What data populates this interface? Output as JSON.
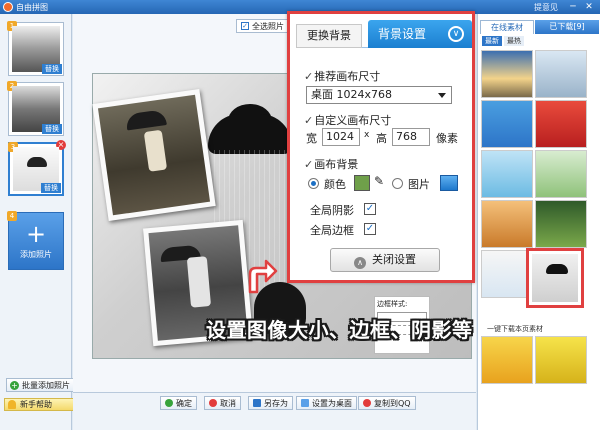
{
  "window": {
    "title": "自由拼图",
    "feedback": "提意见",
    "min_glyph": "─",
    "close_glyph": "✕"
  },
  "left_panel": {
    "thumbnails": [
      {
        "index": "1",
        "swap_label": "替换",
        "selected": false
      },
      {
        "index": "2",
        "swap_label": "替换",
        "selected": false
      },
      {
        "index": "3",
        "swap_label": "替换",
        "selected": true
      },
      {
        "index": "4",
        "swap_label": "",
        "selected": false
      }
    ],
    "add_photo_label": "添加照片",
    "batch_add_label": "批量添加照片",
    "help_label": "新手帮助"
  },
  "toolbar": {
    "select_all_label": "全选照片"
  },
  "settings_panel": {
    "tab_change_bg": "更换背景",
    "tab_bg_settings": "背景设置",
    "recommended_size_label": "推荐画布尺寸",
    "recommended_size_value": "桌面 1024x768",
    "custom_size_label": "自定义画布尺寸",
    "width_label": "宽",
    "width_value": "1024",
    "times": "x",
    "height_label": "高",
    "height_value": "768",
    "unit": "像素",
    "canvas_bg_label": "画布背景",
    "color_option": "颜色",
    "image_option": "图片",
    "bg_color": "#6fa04a",
    "shadow_label": "全局阴影",
    "border_label": "全局边框",
    "close_label": "关闭设置"
  },
  "overlay_text": "设置图像大小、边框、阴影等",
  "border_style_label": "边框样式:",
  "bottom_buttons": {
    "confirm": "确定",
    "cancel": "取消",
    "save_as": "另存为",
    "set_wallpaper": "设置为桌面",
    "copy_qq": "复制到QQ"
  },
  "right_panel": {
    "tab_online": "在线素材",
    "tab_downloaded": "已下载[9]",
    "sub_newest": "最新",
    "sub_hottest": "最热",
    "download_all": "一键下载本页素材"
  },
  "colors": {
    "accent": "#2d75c8",
    "highlight_red": "#e04040"
  }
}
